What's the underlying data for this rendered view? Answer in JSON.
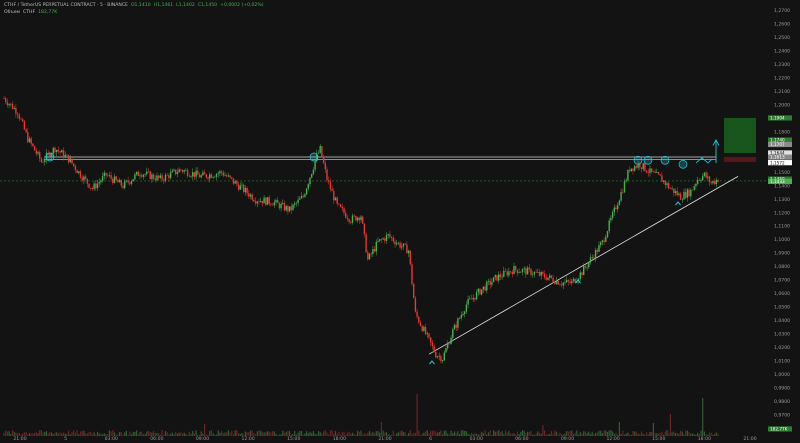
{
  "header": {
    "symbol": "CTHF / TetherUS PERPETUAL CONTRACT · 5 · BINANCE",
    "open": "O1,1410",
    "high": "H1,1461",
    "low": "L1,1402",
    "close": "C1,1450",
    "change": "+0,0002 (+0,02%)",
    "indicator_name": "Объем",
    "indicator_symbol": "CTHF",
    "indicator_value": "182,77K"
  },
  "chart_data": {
    "type": "candlestick",
    "x_tick_labels": [
      "21:00",
      "5",
      "03:00",
      "06:00",
      "09:00",
      "12:00",
      "15:00",
      "18:00",
      "21:00",
      "6",
      "03:00",
      "06:00",
      "09:00",
      "12:00",
      "15:00",
      "18:00",
      "21:00"
    ],
    "y_tick_labels": [
      "1,2700",
      "1,2600",
      "1,2500",
      "1,2400",
      "1,2300",
      "1,2200",
      "1,2100",
      "1,2000",
      "1,1900",
      "1,1800",
      "1,1700",
      "1,1600",
      "1,1500",
      "1,1400",
      "1,1300",
      "1,1200",
      "1,1100",
      "1,1000",
      "1,0900",
      "1,0800",
      "1,0700",
      "1,0600",
      "1,0500",
      "1,0400",
      "1,0300",
      "1,0200",
      "1,0100",
      "1,0000",
      "0,9900",
      "0,9800",
      "0,9700",
      "0,9600"
    ],
    "ylim": [
      0.955,
      1.275
    ],
    "price_path": [
      [
        0,
        1.205
      ],
      [
        8,
        1.195
      ],
      [
        14,
        1.175
      ],
      [
        22,
        1.158
      ],
      [
        30,
        1.168
      ],
      [
        38,
        1.16
      ],
      [
        44,
        1.15
      ],
      [
        52,
        1.138
      ],
      [
        60,
        1.148
      ],
      [
        70,
        1.14
      ],
      [
        80,
        1.15
      ],
      [
        92,
        1.145
      ],
      [
        104,
        1.152
      ],
      [
        116,
        1.147
      ],
      [
        128,
        1.15
      ],
      [
        138,
        1.14
      ],
      [
        148,
        1.13
      ],
      [
        158,
        1.128
      ],
      [
        168,
        1.122
      ],
      [
        176,
        1.132
      ],
      [
        184,
        1.162
      ],
      [
        186,
        1.167
      ],
      [
        190,
        1.145
      ],
      [
        196,
        1.125
      ],
      [
        204,
        1.115
      ],
      [
        210,
        1.118
      ],
      [
        214,
        1.085
      ],
      [
        220,
        1.098
      ],
      [
        226,
        1.103
      ],
      [
        232,
        1.097
      ],
      [
        238,
        1.092
      ],
      [
        242,
        1.045
      ],
      [
        248,
        1.03
      ],
      [
        254,
        1.015
      ],
      [
        258,
        1.012
      ],
      [
        264,
        1.032
      ],
      [
        272,
        1.052
      ],
      [
        280,
        1.062
      ],
      [
        290,
        1.072
      ],
      [
        300,
        1.078
      ],
      [
        310,
        1.076
      ],
      [
        320,
        1.072
      ],
      [
        328,
        1.068
      ],
      [
        334,
        1.068
      ],
      [
        340,
        1.076
      ],
      [
        346,
        1.087
      ],
      [
        352,
        1.098
      ],
      [
        358,
        1.118
      ],
      [
        364,
        1.138
      ],
      [
        368,
        1.153
      ],
      [
        374,
        1.156
      ],
      [
        380,
        1.15
      ],
      [
        386,
        1.146
      ],
      [
        392,
        1.138
      ],
      [
        398,
        1.132
      ],
      [
        404,
        1.136
      ],
      [
        408,
        1.145
      ],
      [
        412,
        1.148
      ],
      [
        416,
        1.142
      ],
      [
        420,
        1.145
      ]
    ],
    "volume_spikes": [
      [
        243,
        42
      ],
      [
        411,
        38
      ],
      [
        392,
        22
      ],
      [
        118,
        12
      ],
      [
        222,
        14
      ],
      [
        317,
        11
      ],
      [
        362,
        14
      ],
      [
        382,
        13
      ]
    ],
    "resistance_levels": [
      1.1614,
      1.1594
    ],
    "mid_level": 1.1436,
    "trendline": [
      [
        250,
        1.015
      ],
      [
        420,
        1.15
      ]
    ],
    "price_labels": [
      {
        "text": "1,1904",
        "value": 1.1904,
        "color": "#2e7d32"
      },
      {
        "text": "1,1740",
        "value": 1.174,
        "color": "#2e7d32"
      },
      {
        "text": "1,1707",
        "value": 1.1707,
        "color": "#8a8a8a"
      },
      {
        "text": "1,1644",
        "value": 1.1644,
        "color": "#e0e0e0"
      },
      {
        "text": "1,1613",
        "value": 1.1613,
        "color": "#8a8a8a"
      },
      {
        "text": "1,1576",
        "value": 1.1576,
        "color": "#c62828"
      },
      {
        "text": "1,1572",
        "value": 1.1572,
        "color": "#ffffff"
      },
      {
        "text": "1,1450",
        "value": 1.145,
        "color": "#2e7d32"
      },
      {
        "text": "1,1433",
        "value": 1.1433,
        "color": "#4caf50"
      },
      {
        "text": "182,77K",
        "value": 0.9595,
        "color": "#2e7d32"
      }
    ],
    "grid": false
  },
  "colors": {
    "background": "#131313",
    "up": "#4caf50",
    "down": "#e53935",
    "annotation": "#26c6da",
    "target_zone": "#1b5e20",
    "stop_zone": "#5d1a1a"
  }
}
